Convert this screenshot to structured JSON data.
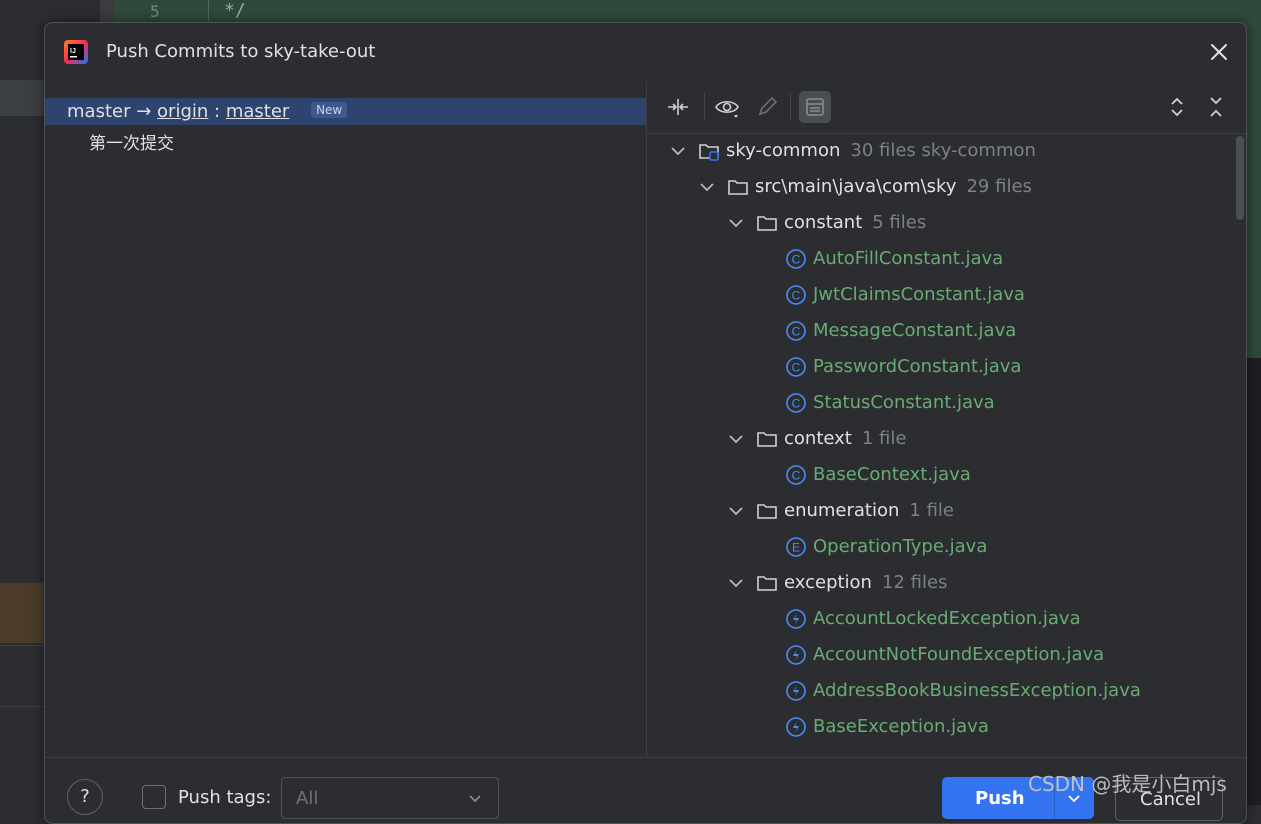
{
  "background": {
    "line_number": "5",
    "code_text": "*/"
  },
  "dialog": {
    "title": "Push Commits to sky-take-out",
    "app_icon": "intellij-idea-icon",
    "close_icon": "close-icon"
  },
  "branches": {
    "local": "master",
    "arrow": "→",
    "remote": "origin",
    "separator": ":",
    "remote_branch": "master",
    "badge": "New",
    "commit": "第一次提交"
  },
  "toolbar": {
    "icons": [
      "collapse-icon",
      "eye-icon",
      "edit-icon",
      "group-icon",
      "expand-all-icon",
      "collapse-all-icon"
    ]
  },
  "tree": [
    {
      "name": "sky-common",
      "meta": "30 files  sky-common",
      "type": "module"
    },
    {
      "name": "src\\main\\java\\com\\sky",
      "meta": "29 files",
      "type": "folder"
    },
    {
      "name": "constant",
      "meta": "5 files",
      "type": "folder"
    },
    {
      "name": "AutoFillConstant.java",
      "meta": "",
      "type": "class"
    },
    {
      "name": "JwtClaimsConstant.java",
      "meta": "",
      "type": "class"
    },
    {
      "name": "MessageConstant.java",
      "meta": "",
      "type": "class"
    },
    {
      "name": "PasswordConstant.java",
      "meta": "",
      "type": "class"
    },
    {
      "name": "StatusConstant.java",
      "meta": "",
      "type": "class"
    },
    {
      "name": "context",
      "meta": "1 file",
      "type": "folder"
    },
    {
      "name": "BaseContext.java",
      "meta": "",
      "type": "class"
    },
    {
      "name": "enumeration",
      "meta": "1 file",
      "type": "folder"
    },
    {
      "name": "OperationType.java",
      "meta": "",
      "type": "enum"
    },
    {
      "name": "exception",
      "meta": "12 files",
      "type": "folder"
    },
    {
      "name": "AccountLockedException.java",
      "meta": "",
      "type": "exception"
    },
    {
      "name": "AccountNotFoundException.java",
      "meta": "",
      "type": "exception"
    },
    {
      "name": "AddressBookBusinessException.java",
      "meta": "",
      "type": "exception"
    },
    {
      "name": "BaseException.java",
      "meta": "",
      "type": "exception"
    }
  ],
  "footer": {
    "help": "?",
    "push_tags_label": "Push tags:",
    "tags_value": "All",
    "push_label": "Push",
    "cancel_label": "Cancel"
  },
  "watermark": "CSDN @我是小白mjs",
  "colors": {
    "accent": "#3574f0",
    "selection": "#2e436e",
    "file_added": "#6aab73",
    "muted": "#7d8085"
  }
}
